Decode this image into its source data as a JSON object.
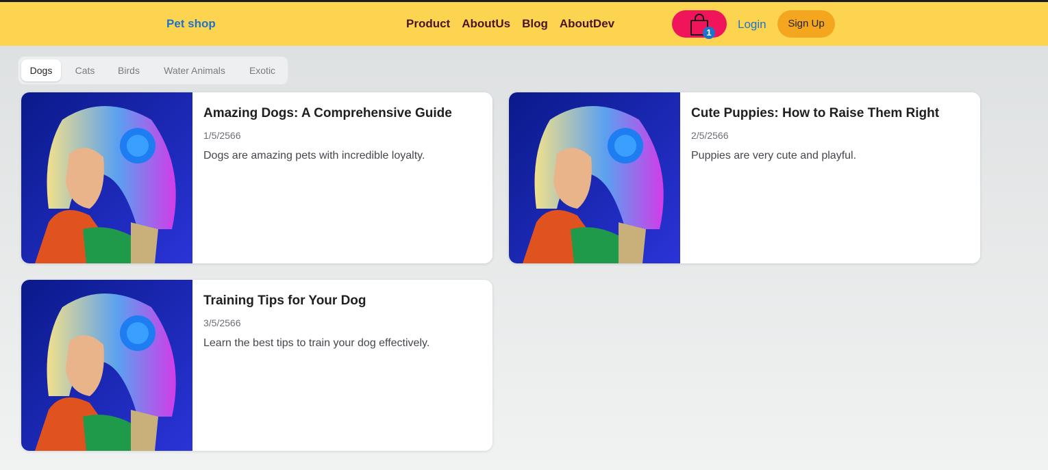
{
  "navbar": {
    "brand": "Pet shop",
    "links": [
      "Product",
      "AboutUs",
      "Blog",
      "AboutDev"
    ],
    "cart_count": "1",
    "login": "Login",
    "signup": "Sign Up"
  },
  "tabs": {
    "items": [
      "Dogs",
      "Cats",
      "Birds",
      "Water Animals",
      "Exotic"
    ],
    "active": "Dogs"
  },
  "posts": [
    {
      "title": "Amazing Dogs: A Comprehensive Guide",
      "date": "1/5/2566",
      "description": "Dogs are amazing pets with incredible loyalty."
    },
    {
      "title": "Cute Puppies: How to Raise Them Right",
      "date": "2/5/2566",
      "description": "Puppies are very cute and playful."
    },
    {
      "title": "Training Tips for Your Dog",
      "date": "3/5/2566",
      "description": "Learn the best tips to train your dog effectively."
    }
  ],
  "colors": {
    "navbar_bg": "#fdd450",
    "brand_blue": "#1e73c8",
    "cart_pink": "#f0145a",
    "signup_orange": "#f4a61f",
    "nav_text": "#4a1426"
  },
  "icons": {
    "cart": "shopping-bag-icon"
  }
}
